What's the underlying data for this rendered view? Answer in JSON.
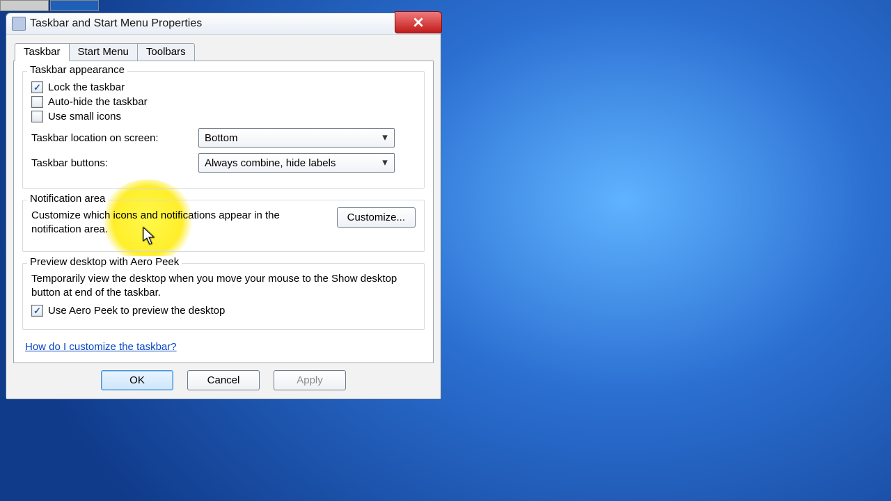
{
  "desktop": {
    "icons": [
      "app1",
      "app2"
    ]
  },
  "window": {
    "title": "Taskbar and Start Menu Properties",
    "close_label": "Close"
  },
  "tabs": {
    "taskbar": "Taskbar",
    "startmenu": "Start Menu",
    "toolbars": "Toolbars"
  },
  "group_appearance": {
    "legend": "Taskbar appearance",
    "lock_label": "Lock the taskbar",
    "autohide_label": "Auto-hide the taskbar",
    "small_icons_label": "Use small icons",
    "location_label": "Taskbar location on screen:",
    "location_value": "Bottom",
    "buttons_label": "Taskbar buttons:",
    "buttons_value": "Always combine, hide labels"
  },
  "group_notif": {
    "legend": "Notification area",
    "helptext": "Customize which icons and notifications appear in the notification area.",
    "customize_label": "Customize..."
  },
  "group_peek": {
    "legend": "Preview desktop with Aero Peek",
    "helptext": "Temporarily view the desktop when you move your mouse to the Show desktop button at end of the taskbar.",
    "chk_label": "Use Aero Peek to preview the desktop"
  },
  "help_link": "How do I customize the taskbar?",
  "buttons": {
    "ok": "OK",
    "cancel": "Cancel",
    "apply": "Apply"
  },
  "checkbox_state": {
    "lock": true,
    "autohide": false,
    "small": false,
    "peek": true
  }
}
